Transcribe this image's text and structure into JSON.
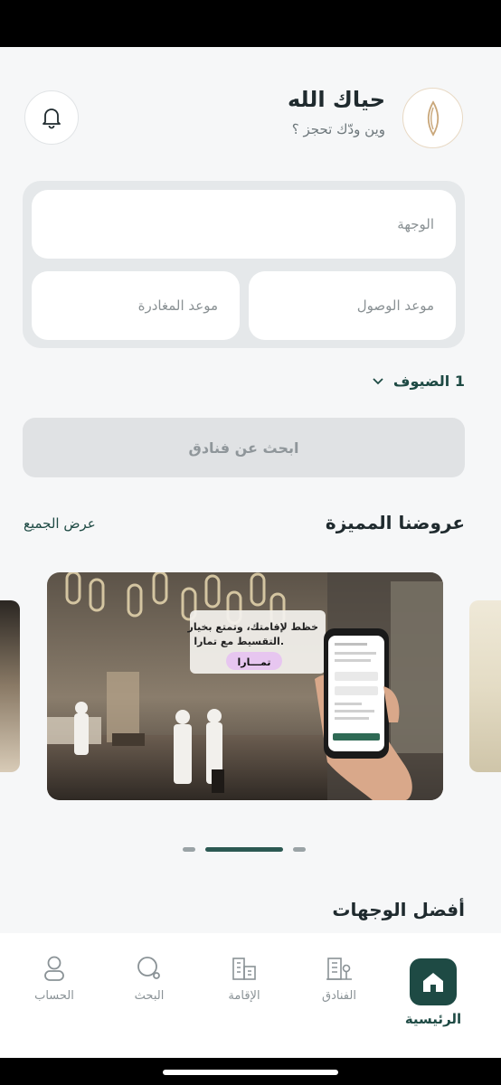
{
  "header": {
    "greeting": "حياك الله",
    "subtitle": "وين ودّك تحجز ؟"
  },
  "search": {
    "destination_placeholder": "الوجهة",
    "arrival_placeholder": "موعد الوصول",
    "departure_placeholder": "موعد المغادرة",
    "guests_label": "1 الضيوف",
    "search_button": "ابحث عن فنادق"
  },
  "offers": {
    "title": "عروضنا المميزة",
    "view_all": "عرض الجميع",
    "banner": {
      "headline_1": "خظط لإقامتك، وتمتع بخيار",
      "headline_2": "التقسيط مع تمارا.",
      "brand": "تمـــارا"
    },
    "page_count": 3,
    "active_page": 1
  },
  "destinations": {
    "title": "أفضل الوجهات"
  },
  "tabbar": {
    "items": [
      {
        "label": "الرئيسية",
        "icon": "home-icon",
        "active": true
      },
      {
        "label": "الفنادق",
        "icon": "hotel-building-icon",
        "active": false
      },
      {
        "label": "الإقامة",
        "icon": "residence-icon",
        "active": false
      },
      {
        "label": "البحث",
        "icon": "search-icon",
        "active": false
      },
      {
        "label": "الحساب",
        "icon": "user-icon",
        "active": false
      }
    ]
  },
  "colors": {
    "primary": "#1e4a44",
    "background": "#f6f7f8",
    "panel": "#e5e8ea",
    "logo_gold": "#c9a77a"
  }
}
